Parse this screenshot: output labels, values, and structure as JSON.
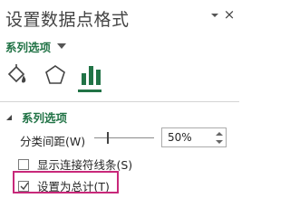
{
  "pane": {
    "title": "设置数据点格式",
    "title_options_icon": "chevron-down-icon",
    "close_glyph": "×"
  },
  "series_dropdown": {
    "label": "系列选项"
  },
  "tabs": [
    {
      "name": "fill-line",
      "icon": "paint-bucket-icon"
    },
    {
      "name": "effects",
      "icon": "pentagon-icon"
    },
    {
      "name": "series-options",
      "icon": "bar-chart-icon",
      "selected": true
    }
  ],
  "section": {
    "label": "系列选项",
    "expanded": true
  },
  "gap_width": {
    "label": "分类间距(W)",
    "value": "50%",
    "slider_fraction": 0.16
  },
  "checkboxes": [
    {
      "label": "显示连接符线条(S)",
      "checked": false
    },
    {
      "label": "设置为总计(T)",
      "checked": true
    }
  ],
  "colors": {
    "accent": "#217346",
    "highlight": "#c8287a"
  }
}
